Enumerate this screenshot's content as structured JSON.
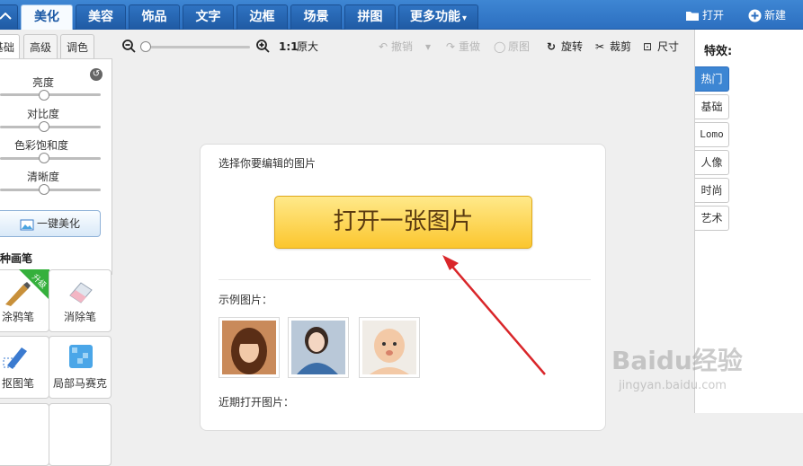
{
  "top_tabs": [
    {
      "label": "美化",
      "active": true
    },
    {
      "label": "美容",
      "active": false
    },
    {
      "label": "饰品",
      "active": false
    },
    {
      "label": "文字",
      "active": false
    },
    {
      "label": "边框",
      "active": false
    },
    {
      "label": "场景",
      "active": false
    },
    {
      "label": "拼图",
      "active": false
    },
    {
      "label": "更多功能",
      "active": false
    }
  ],
  "top_actions": {
    "open": "打开",
    "new": "新建"
  },
  "left": {
    "subtabs": [
      "基础",
      "高级",
      "调色"
    ],
    "sliders": [
      {
        "label": "亮度",
        "value": 0.45
      },
      {
        "label": "对比度",
        "value": 0.45
      },
      {
        "label": "色彩饱和度",
        "value": 0.45
      },
      {
        "label": "清晰度",
        "value": 0.45
      }
    ],
    "one_click": "一键美化",
    "brush_section": "种画笔",
    "tools": [
      {
        "label": "涂鸦笔",
        "badge": "升级"
      },
      {
        "label": "消除笔"
      },
      {
        "label": "抠图笔"
      },
      {
        "label": "局部马赛克"
      }
    ]
  },
  "toolbar": {
    "zoom_ratio": "1:1",
    "original_size": "原大",
    "undo": "撤销",
    "redo": "重做",
    "original": "原图",
    "rotate": "旋转",
    "crop": "裁剪",
    "size": "尺寸"
  },
  "card": {
    "title": "选择你要编辑的图片",
    "open_button": "打开一张图片",
    "sample_title": "示例图片：",
    "recent_title": "近期打开图片："
  },
  "effects": {
    "title": "特效:",
    "tabs": [
      "热门",
      "基础",
      "Lomo",
      "人像",
      "时尚",
      "艺术"
    ],
    "active": "热门"
  },
  "watermark": {
    "main": "Baidu经验",
    "sub": "jingyan.baidu.com"
  },
  "colors": {
    "accent": "#2c6fc0",
    "button_yellow": "#fbc62e",
    "arrow": "#d9262a"
  }
}
